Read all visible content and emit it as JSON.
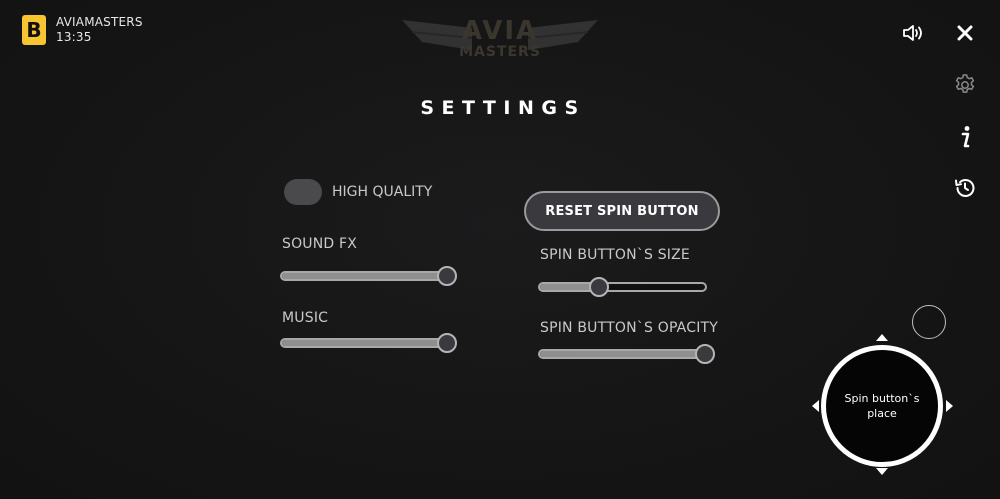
{
  "brand": {
    "logo_letter": "B",
    "name": "AVIAMASTERS",
    "time": "13:35",
    "logo_color": "#f7c531"
  },
  "game_logo": {
    "line1": "AVIA",
    "line2": "MASTERS"
  },
  "toolbar": {
    "sound_icon": "speaker-icon",
    "close_icon": "close-icon",
    "settings_icon": "gear-icon",
    "info_icon": "info-icon",
    "history_icon": "history-icon"
  },
  "settings": {
    "title": "SETTINGS",
    "high_quality": {
      "label": "HIGH QUALITY",
      "enabled": false
    },
    "sound_fx": {
      "label": "SOUND FX",
      "value": 1.0
    },
    "music": {
      "label": "MUSIC",
      "value": 1.0
    },
    "reset_button_label": "RESET SPIN BUTTON",
    "spin_size": {
      "label": "SPIN BUTTON`S SIZE",
      "value": 0.37
    },
    "spin_opacity": {
      "label": "SPIN BUTTON`S OPACITY",
      "value": 1.0
    }
  },
  "spin_placeholder": {
    "text": "Spin button`s place"
  },
  "colors": {
    "background": "#141414",
    "accent": "#f7c531",
    "text": "#ffffff"
  }
}
